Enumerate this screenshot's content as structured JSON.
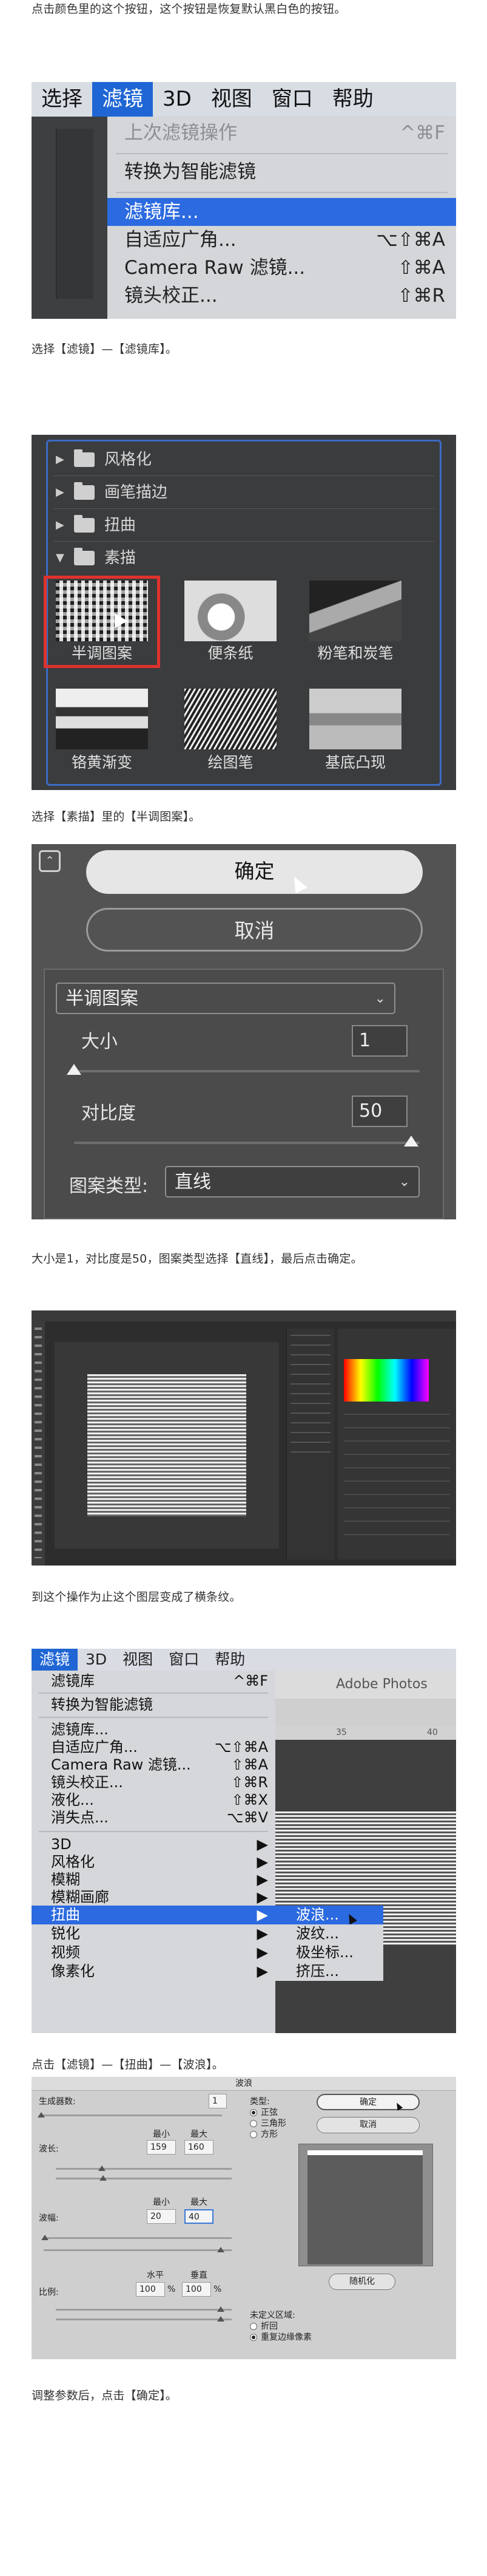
{
  "intro": "点击颜色里的这个按钮，这个按钮是恢复默认黑白色的按钮。",
  "section1": {
    "menubar": [
      "选择",
      "滤镜",
      "3D",
      "视图",
      "窗口",
      "帮助"
    ],
    "items": [
      {
        "label": "上次滤镜操作",
        "shortcut": "^⌘F"
      },
      {
        "label": "转换为智能滤镜",
        "shortcut": ""
      },
      {
        "label": "滤镜库...",
        "shortcut": ""
      },
      {
        "label": "自适应广角...",
        "shortcut": "⌥⇧⌘A"
      },
      {
        "label": "Camera Raw 滤镜...",
        "shortcut": "⇧⌘A"
      },
      {
        "label": "镜头校正...",
        "shortcut": "⇧⌘R"
      }
    ],
    "caption": "选择【滤镜】—【滤镜库】。"
  },
  "section2": {
    "folders": [
      "风格化",
      "画笔描边",
      "扭曲",
      "素描"
    ],
    "thumbs": [
      "半调图案",
      "便条纸",
      "粉笔和炭笔",
      "铬黄渐变",
      "绘图笔",
      "基底凸现"
    ],
    "caption": "选择【素描】里的【半调图案】。"
  },
  "section3": {
    "ok": "确定",
    "cancel": "取消",
    "filter_name": "半调图案",
    "size_label": "大小",
    "size_value": "1",
    "contrast_label": "对比度",
    "contrast_value": "50",
    "pattern_label": "图案类型:",
    "pattern_value": "直线",
    "caption": "大小是1，对比度是50，图案类型选择【直线】，最后点击确定。"
  },
  "section4": {
    "caption": "到这个操作为止这个图层变成了横条纹。"
  },
  "section5": {
    "menubar": [
      "滤镜",
      "3D",
      "视图",
      "窗口",
      "帮助"
    ],
    "app_title": "Adobe Photos",
    "ruler": [
      "35",
      "40"
    ],
    "items": [
      {
        "label": "滤镜库",
        "shortcut": "^⌘F"
      },
      {
        "label": "转换为智能滤镜",
        "shortcut": ""
      },
      {
        "label": "滤镜库...",
        "shortcut": ""
      },
      {
        "label": "自适应广角...",
        "shortcut": "⌥⇧⌘A"
      },
      {
        "label": "Camera Raw 滤镜...",
        "shortcut": "⇧⌘A"
      },
      {
        "label": "镜头校正...",
        "shortcut": "⇧⌘R"
      },
      {
        "label": "液化...",
        "shortcut": "⇧⌘X"
      },
      {
        "label": "消失点...",
        "shortcut": "⌥⌘V"
      },
      {
        "label": "3D",
        "shortcut": "▶"
      },
      {
        "label": "风格化",
        "shortcut": "▶"
      },
      {
        "label": "模糊",
        "shortcut": "▶"
      },
      {
        "label": "模糊画廊",
        "shortcut": "▶"
      },
      {
        "label": "扭曲",
        "shortcut": "▶"
      },
      {
        "label": "锐化",
        "shortcut": "▶"
      },
      {
        "label": "视频",
        "shortcut": "▶"
      },
      {
        "label": "像素化",
        "shortcut": "▶"
      }
    ],
    "submenu": [
      "波浪...",
      "波纹...",
      "极坐标...",
      "挤压..."
    ],
    "caption": "点击【滤镜】—【扭曲】—【波浪】。"
  },
  "section6": {
    "title": "波浪",
    "generators_label": "生成器数:",
    "generators_value": "1",
    "wavelength_label": "波长:",
    "amplitude_label": "波幅:",
    "min_label": "最小",
    "max_label": "最大",
    "wavelength_min": "159",
    "wavelength_max": "160",
    "amplitude_min": "20",
    "amplitude_max": "40",
    "scale_label": "比例:",
    "horizontal_label": "水平",
    "vertical_label": "垂直",
    "scale_h": "100",
    "scale_v": "100",
    "percent": "%",
    "type_label": "类型:",
    "types": [
      "正弦",
      "三角形",
      "方形"
    ],
    "ok": "确定",
    "cancel": "取消",
    "randomize": "随机化",
    "undefined_label": "未定义区域:",
    "undefined_opts": [
      "折回",
      "重复边缘像素"
    ],
    "caption": "调整参数后，点击【确定】。"
  },
  "colors": {
    "menu_highlight": "#2b6ae0",
    "red_frame": "#e0312c",
    "gallery_frame": "#3b6bc6"
  }
}
